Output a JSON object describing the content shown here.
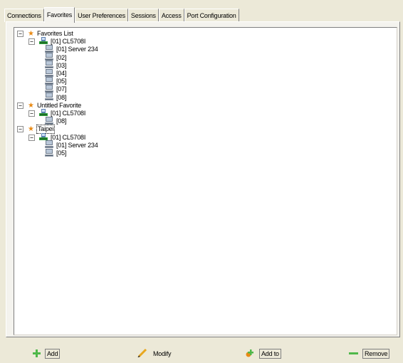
{
  "tabs": [
    {
      "label": "Connections",
      "active": false
    },
    {
      "label": "Favorites",
      "active": true
    },
    {
      "label": "User Preferences",
      "active": false
    },
    {
      "label": "Sessions",
      "active": false
    },
    {
      "label": "Access",
      "active": false
    },
    {
      "label": "Port Configuration",
      "active": false
    }
  ],
  "tree": [
    {
      "label": "Favorites List",
      "icon": "star-icon",
      "level": 0,
      "expander": "−"
    },
    {
      "label": "[01] CL5708I",
      "icon": "switch-icon",
      "level": 1,
      "expander": "−"
    },
    {
      "label": "[01] Server 234",
      "icon": "computer-icon",
      "level": 2
    },
    {
      "label": "[02]",
      "icon": "computer-icon",
      "level": 2
    },
    {
      "label": "[03]",
      "icon": "computer-icon",
      "level": 2
    },
    {
      "label": "[04]",
      "icon": "computer-icon",
      "level": 2
    },
    {
      "label": "[05]",
      "icon": "computer-icon",
      "level": 2
    },
    {
      "label": "[07]",
      "icon": "computer-icon",
      "level": 2
    },
    {
      "label": "[08]",
      "icon": "computer-icon",
      "level": 2
    },
    {
      "label": "Untitled Favorite",
      "icon": "star-icon",
      "level": 0,
      "expander": "−"
    },
    {
      "label": "[01] CL5708I",
      "icon": "switch-icon",
      "level": 1,
      "expander": "−"
    },
    {
      "label": "[08]",
      "icon": "computer-icon",
      "level": 2
    },
    {
      "label": "Taipei",
      "icon": "star-icon",
      "level": 0,
      "expander": "−",
      "selected": true
    },
    {
      "label": "[01] CL5708I",
      "icon": "switch-icon",
      "level": 1,
      "expander": "−"
    },
    {
      "label": "[01] Server 234",
      "icon": "computer-icon",
      "level": 2
    },
    {
      "label": "[05]",
      "icon": "computer-icon",
      "level": 2
    }
  ],
  "buttons": {
    "add": {
      "label": "Add",
      "icon": "plus-icon"
    },
    "modify": {
      "label": "Modify",
      "icon": "pencil-icon"
    },
    "addto": {
      "label": "Add to",
      "icon": "add-to-icon"
    },
    "remove": {
      "label": "Remove",
      "icon": "minus-icon"
    }
  },
  "colors": {
    "window_bg": "#ECE9D8",
    "star": "#E98A15",
    "switch_green": "#2E9E3A",
    "plus_green": "#4FB84A"
  }
}
